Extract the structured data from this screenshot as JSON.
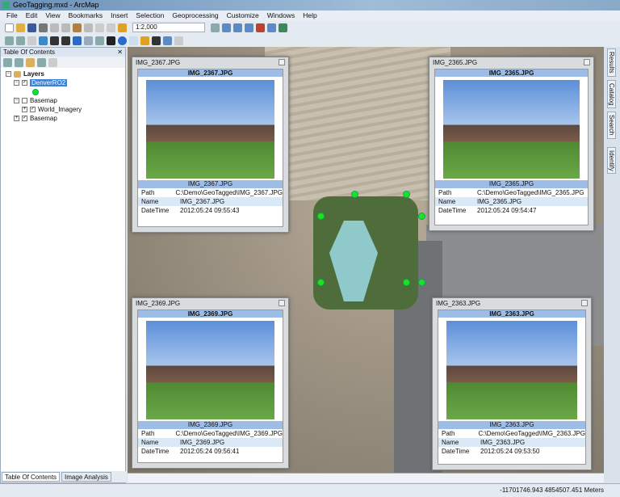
{
  "window": {
    "title": "GeoTagging.mxd - ArcMap"
  },
  "menu": [
    "File",
    "Edit",
    "View",
    "Bookmarks",
    "Insert",
    "Selection",
    "Geoprocessing",
    "Customize",
    "Windows",
    "Help"
  ],
  "toolbar": {
    "scale": "1:2,000"
  },
  "toc": {
    "title": "Table Of Contents",
    "layers_label": "Layers",
    "items": [
      {
        "label": "DenverRO2",
        "checked": true
      },
      {
        "label": "Basemap",
        "checked": false
      },
      {
        "label": "World_Imagery",
        "checked": true
      },
      {
        "label": "Basemap",
        "checked": true
      }
    ],
    "tabs": [
      "Table Of Contents",
      "Image Analysis"
    ]
  },
  "right_tabs": [
    "Results",
    "Catalog",
    "Search",
    "Identify"
  ],
  "attr_labels": {
    "path": "Path",
    "name": "Name",
    "datetime": "DateTime"
  },
  "popups": [
    {
      "title": "IMG_2367.JPG",
      "path": "C:\\Demo\\GeoTagged\\IMG_2367.JPG",
      "name": "IMG_2367.JPG",
      "datetime": "2012:05:24 09:55:43"
    },
    {
      "title": "IMG_2365.JPG",
      "path": "C:\\Demo\\GeoTagged\\IMG_2365.JPG",
      "name": "IMG_2365.JPG",
      "datetime": "2012:05:24 09:54:47"
    },
    {
      "title": "IMG_2369.JPG",
      "path": "C:\\Demo\\GeoTagged\\IMG_2369.JPG",
      "name": "IMG_2369.JPG",
      "datetime": "2012:05:24 09:56:41"
    },
    {
      "title": "IMG_2363.JPG",
      "path": "C:\\Demo\\GeoTagged\\IMG_2363.JPG",
      "name": "IMG_2363.JPG",
      "datetime": "2012:05:24 09:53:50"
    }
  ],
  "status": {
    "coords": "-11701746.943  4854507.451 Meters"
  }
}
